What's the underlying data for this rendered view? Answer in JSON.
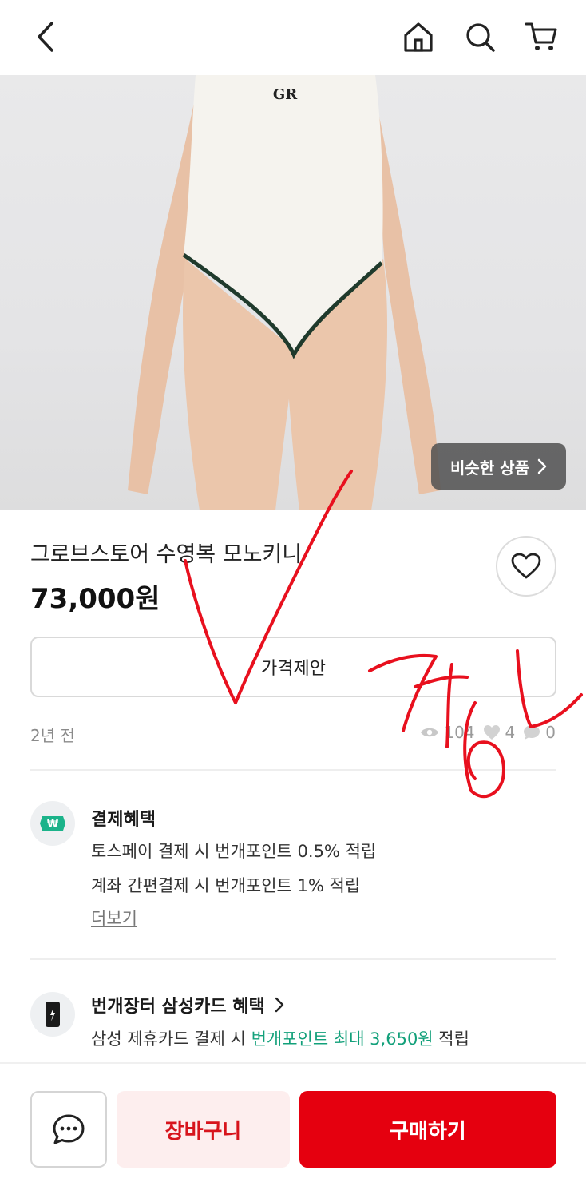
{
  "header": {
    "back_icon": "chevron-left-icon",
    "home_icon": "home-icon",
    "search_icon": "search-icon",
    "cart_icon": "cart-icon"
  },
  "product": {
    "image_logo": "GR",
    "similar_label": "비슷한 상품",
    "title": "그로브스토어 수영복 모노키니",
    "price": "73,000원",
    "offer_label": "가격제안",
    "posted": "2년 전",
    "views": "104",
    "likes": "4",
    "chats": "0"
  },
  "payment_benefit": {
    "title": "결제혜택",
    "line1": "토스페이 결제 시 번개포인트 0.5% 적립",
    "line2": "계좌 간편결제 시 번개포인트 1% 적립",
    "more": "더보기"
  },
  "card_benefit": {
    "title": "번개장터 삼성카드 혜택",
    "prefix": "삼성 제휴카드 결제 시 ",
    "highlight": "번개포인트 최대 3,650원",
    "suffix": " 적립"
  },
  "bottom": {
    "cart_label": "장바구니",
    "buy_label": "구매하기"
  },
  "colors": {
    "accent_red": "#e5000f",
    "highlight_green": "#12a07a",
    "annotation_red": "#e8101e"
  }
}
